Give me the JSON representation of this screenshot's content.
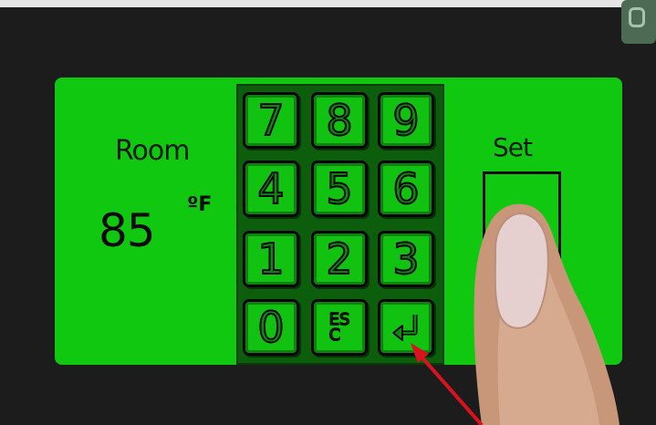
{
  "thermostat": {
    "room_label": "Room",
    "temperature": "85",
    "unit": "ºF",
    "set_label": "Set",
    "set_value": ""
  },
  "keypad": {
    "keys": [
      "7",
      "8",
      "9",
      "4",
      "5",
      "6",
      "1",
      "2",
      "3",
      "0"
    ],
    "esc_label_line1": "ES",
    "esc_label_line2": "C",
    "enter_icon": "enter-arrow-icon"
  },
  "colors": {
    "panel_green": "#10c810",
    "key_green": "#11c211",
    "background": "#1c1c1c",
    "annotation_arrow": "#d8121e"
  }
}
